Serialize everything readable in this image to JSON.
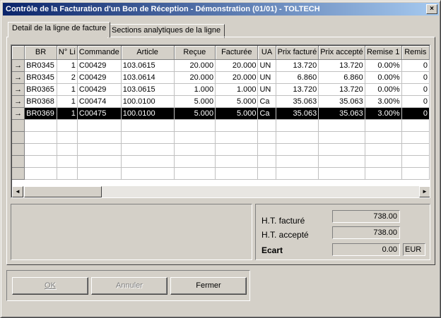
{
  "window": {
    "title": "Contrôle de la Facturation d'un Bon de Réception - Démonstration (01/01) - TOLTECH",
    "close": "×"
  },
  "tabs": [
    {
      "label": "Detail de la ligne de facture"
    },
    {
      "label": "Sections analytiques de la ligne"
    }
  ],
  "grid": {
    "columns": [
      "",
      "BR",
      "N° Li",
      "Commande",
      "Article",
      "Reçue",
      "Facturée",
      "UA",
      "Prix facturé",
      "Prix accepté",
      "Remise 1",
      "Remis"
    ],
    "rows": [
      {
        "marker": "→",
        "br": "BR0345",
        "line": "1",
        "commande": "C00429",
        "article": "103.0615",
        "recue": "20.000",
        "facturee": "20.000",
        "ua": "UN",
        "prix_facture": "13.720",
        "prix_accepte": "13.720",
        "remise1": "0.00%",
        "remise2": "0"
      },
      {
        "marker": "→",
        "br": "BR0345",
        "line": "2",
        "commande": "C00429",
        "article": "103.0614",
        "recue": "20.000",
        "facturee": "20.000",
        "ua": "UN",
        "prix_facture": "6.860",
        "prix_accepte": "6.860",
        "remise1": "0.00%",
        "remise2": "0"
      },
      {
        "marker": "→",
        "br": "BR0365",
        "line": "1",
        "commande": "C00429",
        "article": "103.0615",
        "recue": "1.000",
        "facturee": "1.000",
        "ua": "UN",
        "prix_facture": "13.720",
        "prix_accepte": "13.720",
        "remise1": "0.00%",
        "remise2": "0"
      },
      {
        "marker": "→",
        "br": "BR0368",
        "line": "1",
        "commande": "C00474",
        "article": "100.0100",
        "recue": "5.000",
        "facturee": "5.000",
        "ua": "Ca",
        "prix_facture": "35.063",
        "prix_accepte": "35.063",
        "remise1": "3.00%",
        "remise2": "0"
      },
      {
        "marker": "→",
        "br": "BR0369",
        "line": "1",
        "commande": "C00475",
        "article": "100.0100",
        "recue": "5.000",
        "facturee": "5.000",
        "ua": "Ca",
        "prix_facture": "35.063",
        "prix_accepte": "35.063",
        "remise1": "3.00%",
        "remise2": "0"
      }
    ],
    "selected_row": 4,
    "scroll_left": "◄",
    "scroll_right": "►"
  },
  "totals": {
    "ht_facture_label": "H.T. facturé",
    "ht_facture_value": "738.00",
    "ht_accepte_label": "H.T. accepté",
    "ht_accepte_value": "738.00",
    "ecart_label": "Ecart",
    "ecart_value": "0.00",
    "currency": "EUR"
  },
  "buttons": {
    "ok": "OK",
    "annuler": "Annuler",
    "fermer": "Fermer"
  }
}
